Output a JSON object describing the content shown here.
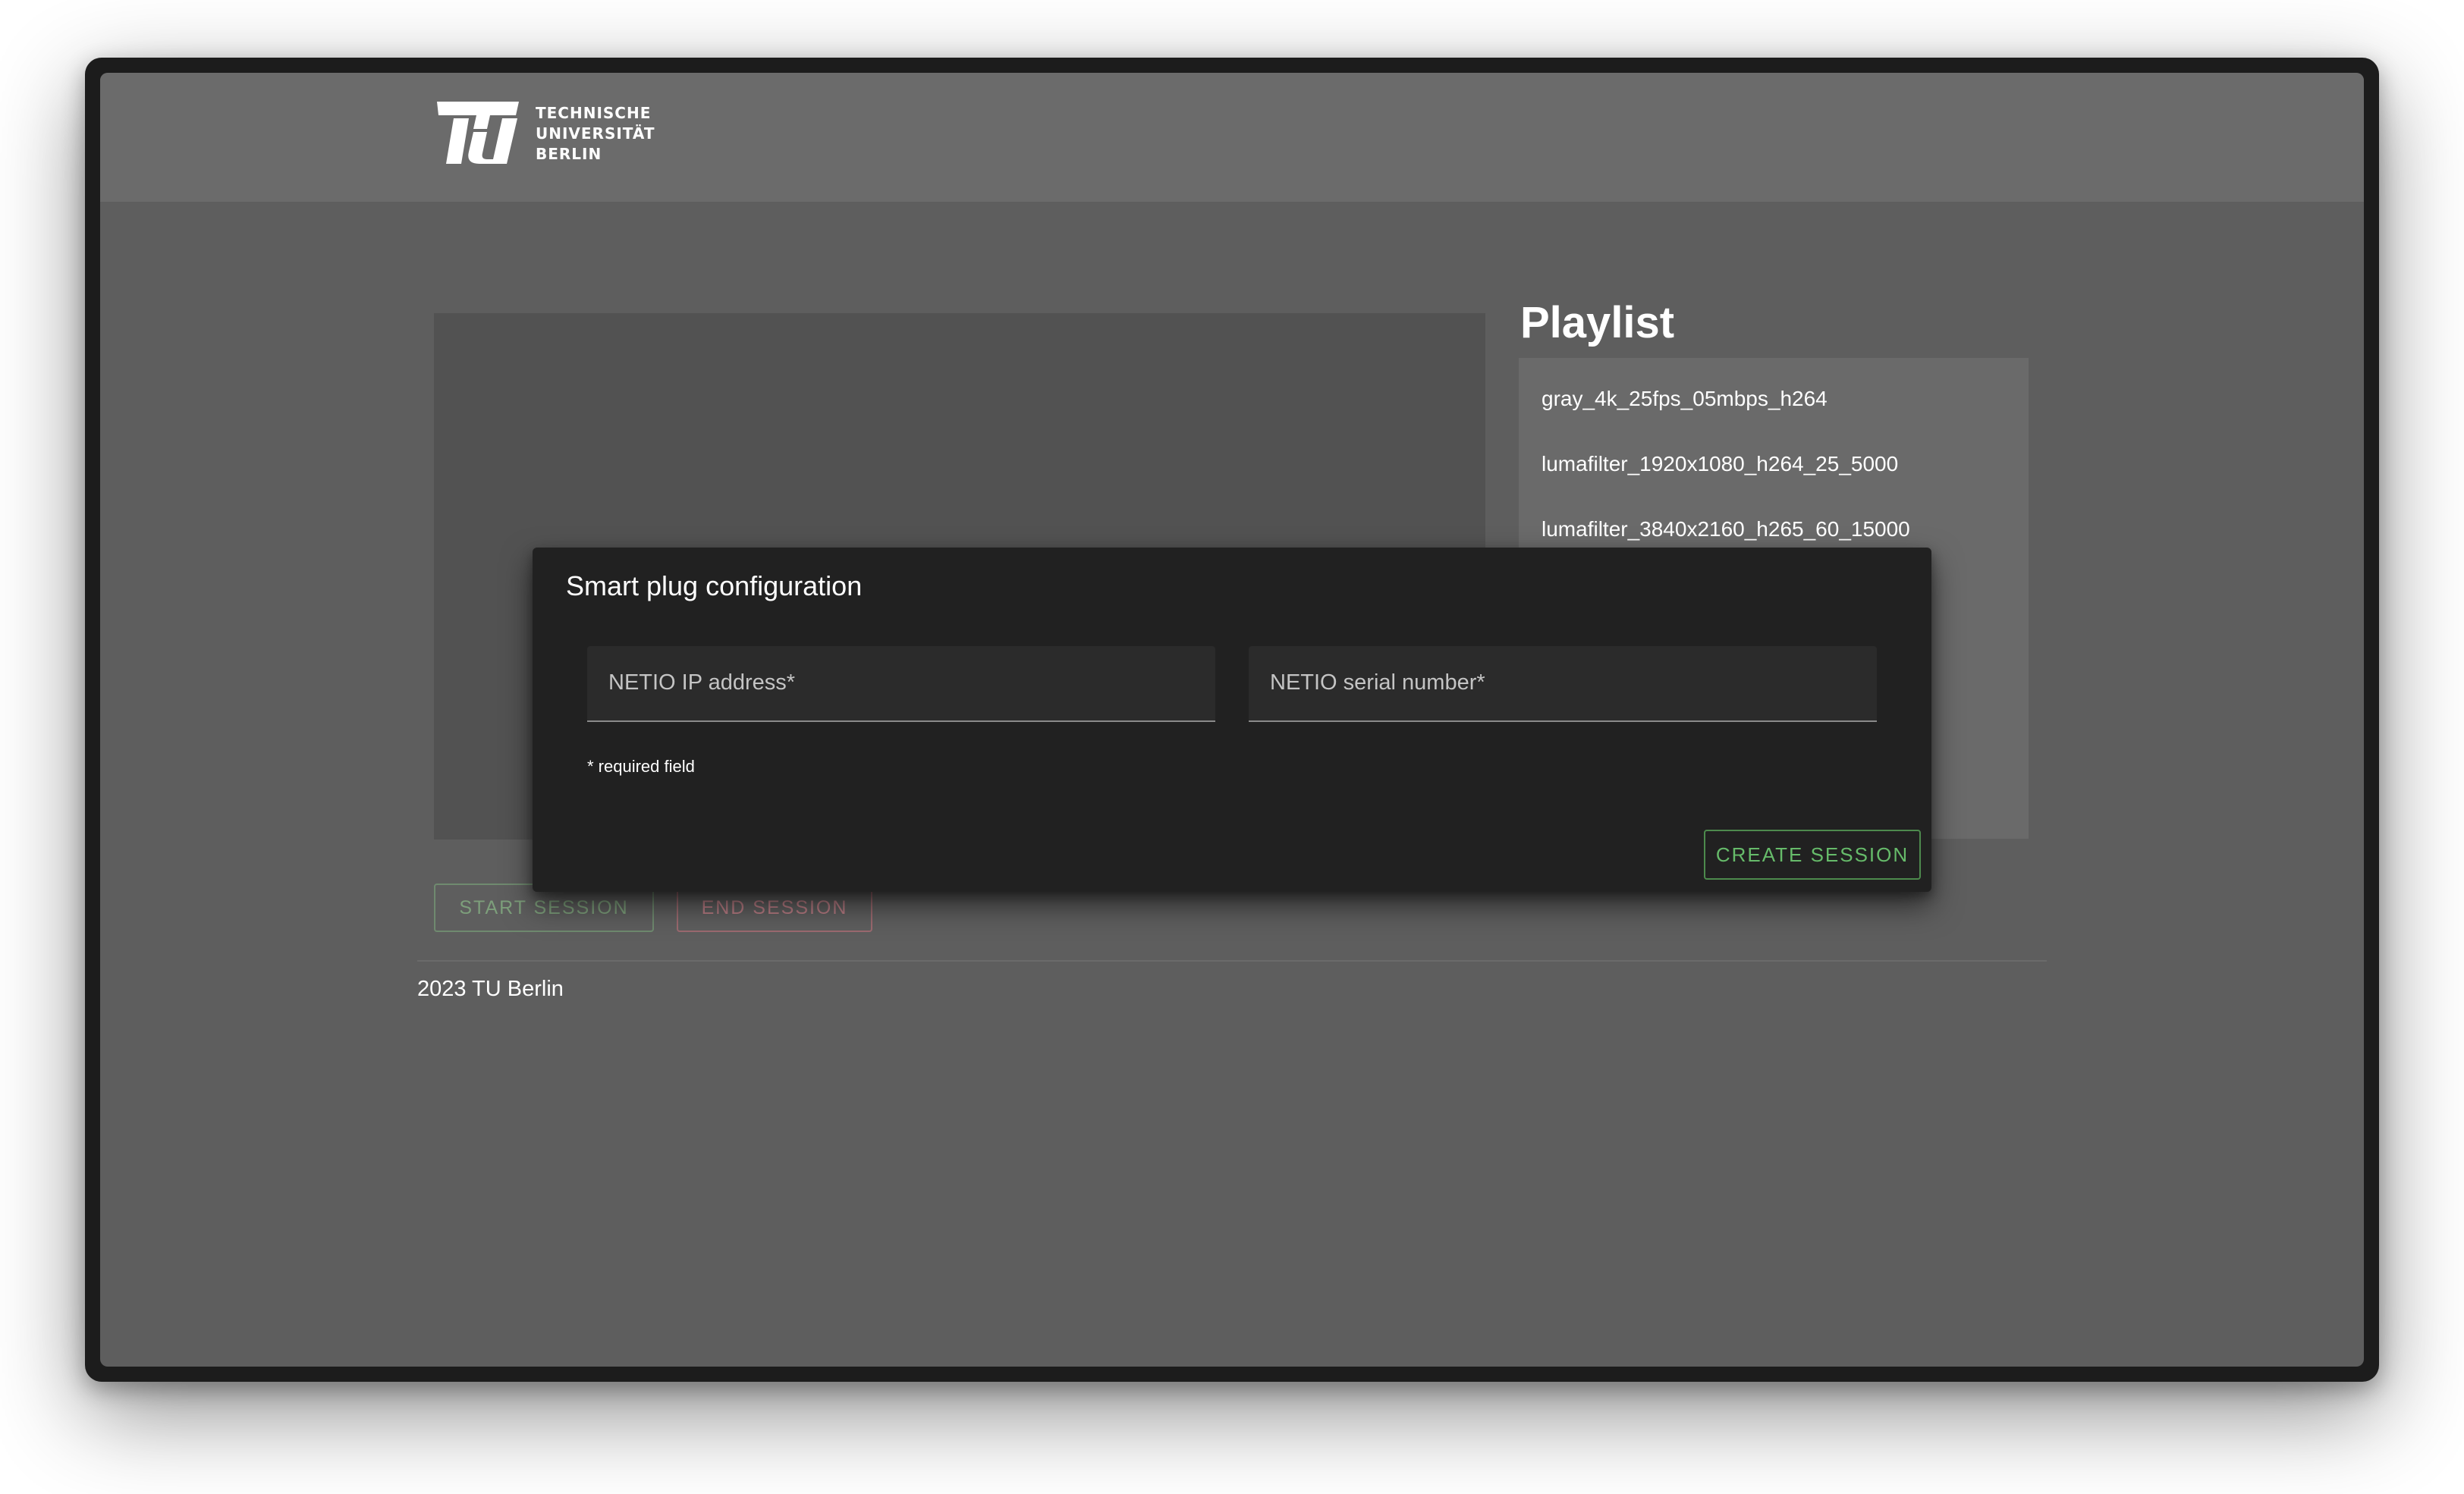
{
  "header": {
    "logo_lines": [
      "TECHNISCHE",
      "UNIVERSITÄT",
      "BERLIN"
    ]
  },
  "playlist": {
    "title": "Playlist",
    "items": [
      "gray_4k_25fps_05mbps_h264",
      "lumafilter_1920x1080_h264_25_5000",
      "lumafilter_3840x2160_h265_60_15000"
    ]
  },
  "controls": {
    "start_label": "START SESSION",
    "end_label": "END SESSION"
  },
  "footer": {
    "text": "2023 TU Berlin"
  },
  "dialog": {
    "title": "Smart plug configuration",
    "ip_label": "NETIO IP address*",
    "serial_label": "NETIO serial number*",
    "required_hint": "* required field",
    "create_label": "CREATE SESSION"
  },
  "colors": {
    "start_accent": "#7d9f7b",
    "end_accent": "#b87c84",
    "create_accent": "#66bb6a",
    "dialog_bg": "#212121",
    "page_bg": "#5e5e5e"
  }
}
